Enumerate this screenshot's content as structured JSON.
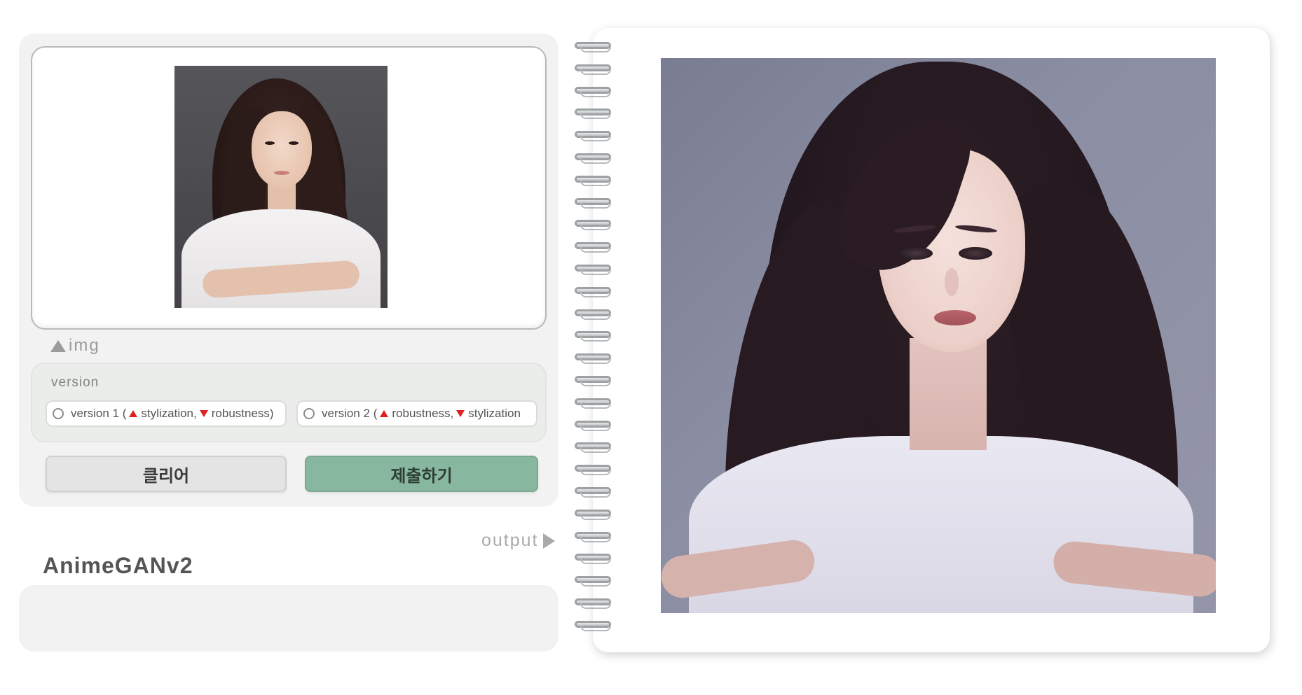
{
  "input": {
    "label": "img",
    "image_alt": "input portrait photo"
  },
  "version": {
    "title": "version",
    "options": [
      {
        "prefix": "version 1 (",
        "up_text": "stylization,",
        "down_text": "robustness)",
        "selected": false
      },
      {
        "prefix": "version 2 (",
        "up_text": "robustness,",
        "down_text": "stylization",
        "selected": false
      }
    ]
  },
  "buttons": {
    "clear_label": "클리어",
    "submit_label": "제출하기"
  },
  "output": {
    "label": "output"
  },
  "app": {
    "title": "AnimeGANv2",
    "description": ""
  },
  "colors": {
    "panel_bg": "#f1f2f1",
    "submit_bg": "#88b7a0",
    "clear_bg": "#e4e4e4",
    "arrow_red": "#e0211d"
  },
  "icons": {
    "img_marker": "triangle-up-icon",
    "output_marker": "triangle-right-icon",
    "up_marker": "red-triangle-up-icon",
    "down_marker": "red-triangle-down-icon"
  }
}
